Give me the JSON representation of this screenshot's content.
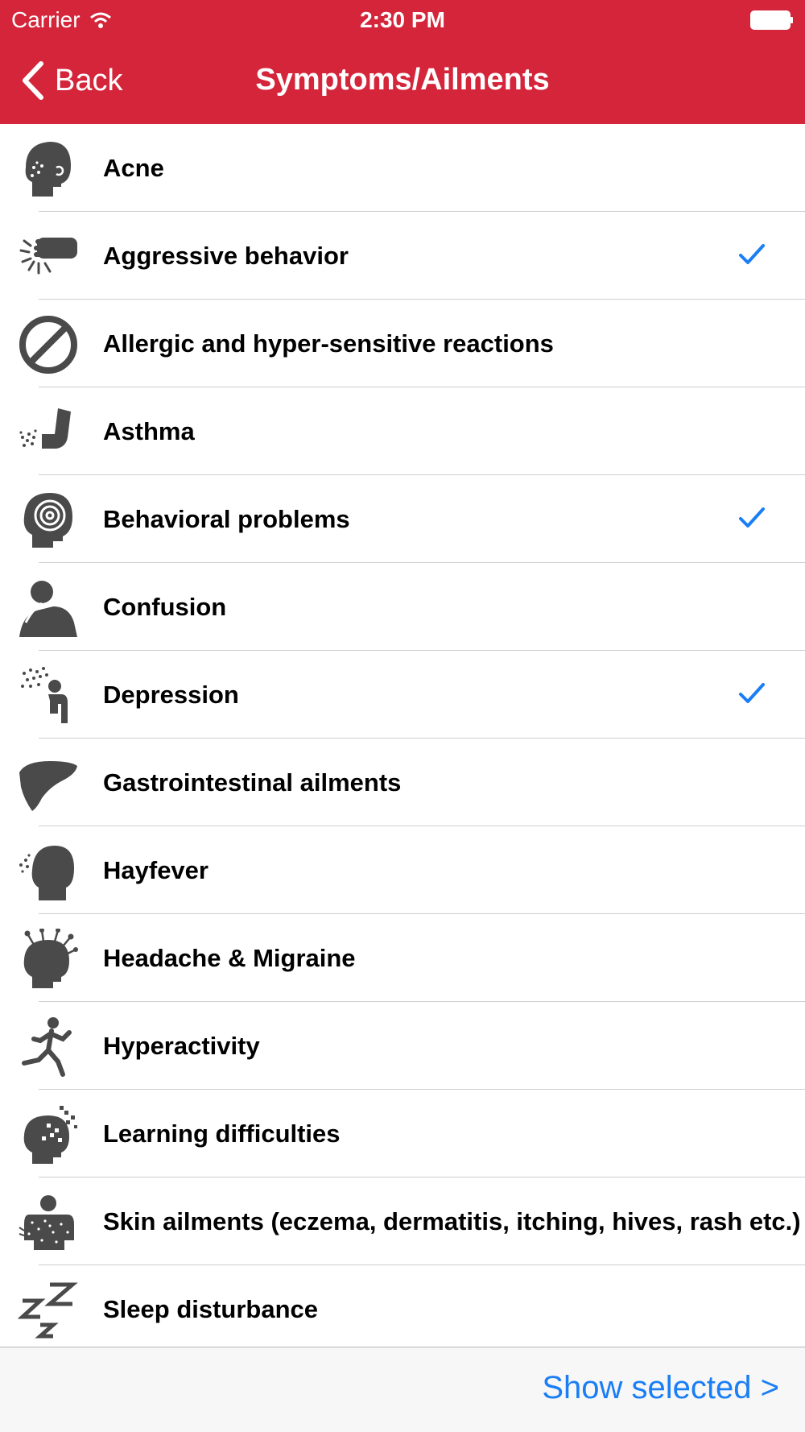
{
  "status_bar": {
    "carrier": "Carrier",
    "time": "2:30 PM"
  },
  "nav": {
    "back_label": "Back",
    "title": "Symptoms/Ailments"
  },
  "colors": {
    "header": "#d4253a",
    "icon": "#4a4a4a",
    "accent": "#1a7ef5"
  },
  "items": [
    {
      "label": "Acne",
      "icon": "acne-icon",
      "checked": false
    },
    {
      "label": "Aggressive behavior",
      "icon": "fist-icon",
      "checked": true
    },
    {
      "label": "Allergic and hyper-sensitive reactions",
      "icon": "prohibited-icon",
      "checked": false
    },
    {
      "label": "Asthma",
      "icon": "inhaler-icon",
      "checked": false
    },
    {
      "label": "Behavioral problems",
      "icon": "spiral-head-icon",
      "checked": true
    },
    {
      "label": "Confusion",
      "icon": "thinking-person-icon",
      "checked": false
    },
    {
      "label": "Depression",
      "icon": "rain-person-icon",
      "checked": true
    },
    {
      "label": "Gastrointestinal ailments",
      "icon": "liver-icon",
      "checked": false
    },
    {
      "label": "Hayfever",
      "icon": "sneeze-head-icon",
      "checked": false
    },
    {
      "label": "Headache & Migraine",
      "icon": "pins-head-icon",
      "checked": false
    },
    {
      "label": "Hyperactivity",
      "icon": "runner-icon",
      "checked": false
    },
    {
      "label": "Learning difficulties",
      "icon": "pixel-head-icon",
      "checked": false
    },
    {
      "label": "Skin ailments (eczema, dermatitis, itching, hives, rash etc.)",
      "icon": "skin-rash-icon",
      "checked": false
    },
    {
      "label": "Sleep disturbance",
      "icon": "zzz-icon",
      "checked": false
    }
  ],
  "toolbar": {
    "show_selected_label": "Show selected >"
  }
}
